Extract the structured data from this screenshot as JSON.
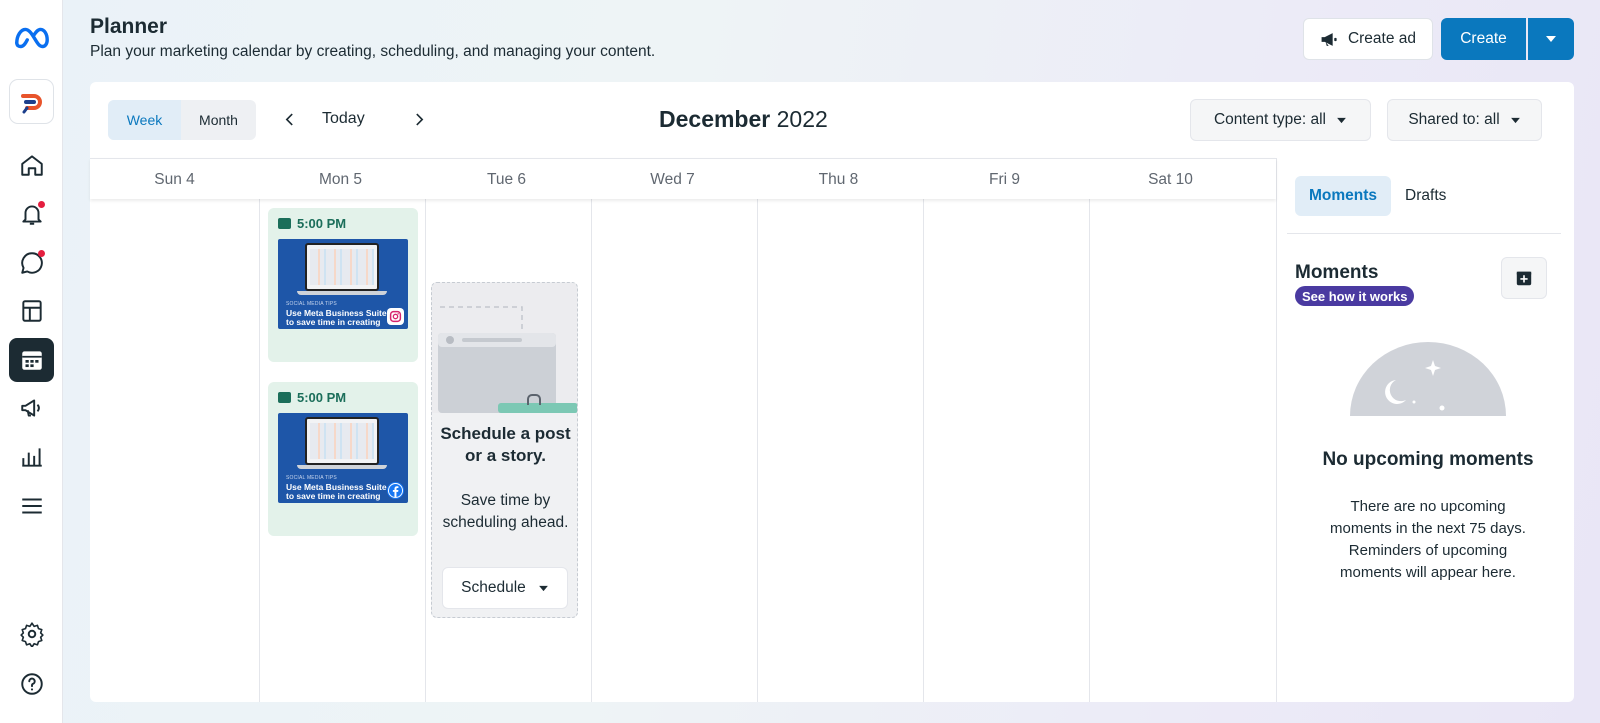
{
  "header": {
    "title": "Planner",
    "subtitle": "Plan your marketing calendar by creating, scheduling, and managing your content.",
    "create_ad_label": "Create ad",
    "create_label": "Create"
  },
  "rail": {
    "icons": [
      "meta-logo-icon",
      "brand-logo-icon",
      "home-icon",
      "notifications-icon",
      "messages-icon",
      "content-icon",
      "planner-icon",
      "ads-megaphone-icon",
      "insights-icon",
      "menu-icon",
      "settings-icon",
      "help-icon"
    ],
    "active": "planner-icon"
  },
  "toolbar": {
    "view_week": "Week",
    "view_month": "Month",
    "selected_view": "Week",
    "today_label": "Today",
    "month_name": "December",
    "year": "2022",
    "content_filter": "Content type: all",
    "shared_filter": "Shared to: all"
  },
  "calendar": {
    "days": [
      "Sun 4",
      "Mon 5",
      "Tue 6",
      "Wed 7",
      "Thu 8",
      "Fri 9",
      "Sat 10"
    ],
    "posts": [
      {
        "day": "Mon 5",
        "time": "5:00 PM",
        "platform": "instagram",
        "thumb_tag": "SOCIAL MEDIA TIPS",
        "thumb_headline": "Use Meta Business Suite to save time in creating"
      },
      {
        "day": "Mon 5",
        "time": "5:00 PM",
        "platform": "facebook",
        "thumb_tag": "SOCIAL MEDIA TIPS",
        "thumb_headline": "Use Meta Business Suite to save time in creating"
      }
    ],
    "schedule_prompt": {
      "title": "Schedule a post or a story.",
      "description": "Save time by scheduling ahead.",
      "button_label": "Schedule"
    }
  },
  "side_panel": {
    "tab_moments": "Moments",
    "tab_drafts": "Drafts",
    "moments_title": "Moments",
    "badge_label": "See how it works",
    "empty_title": "No upcoming moments",
    "empty_description": "There are no upcoming moments in the next 75 days. Reminders of upcoming moments will appear here."
  },
  "colors": {
    "accent": "#0a78be",
    "post_bg": "#e3f2ea",
    "badge": "#4a3aa1",
    "notification_dot": "#e41e3f"
  }
}
